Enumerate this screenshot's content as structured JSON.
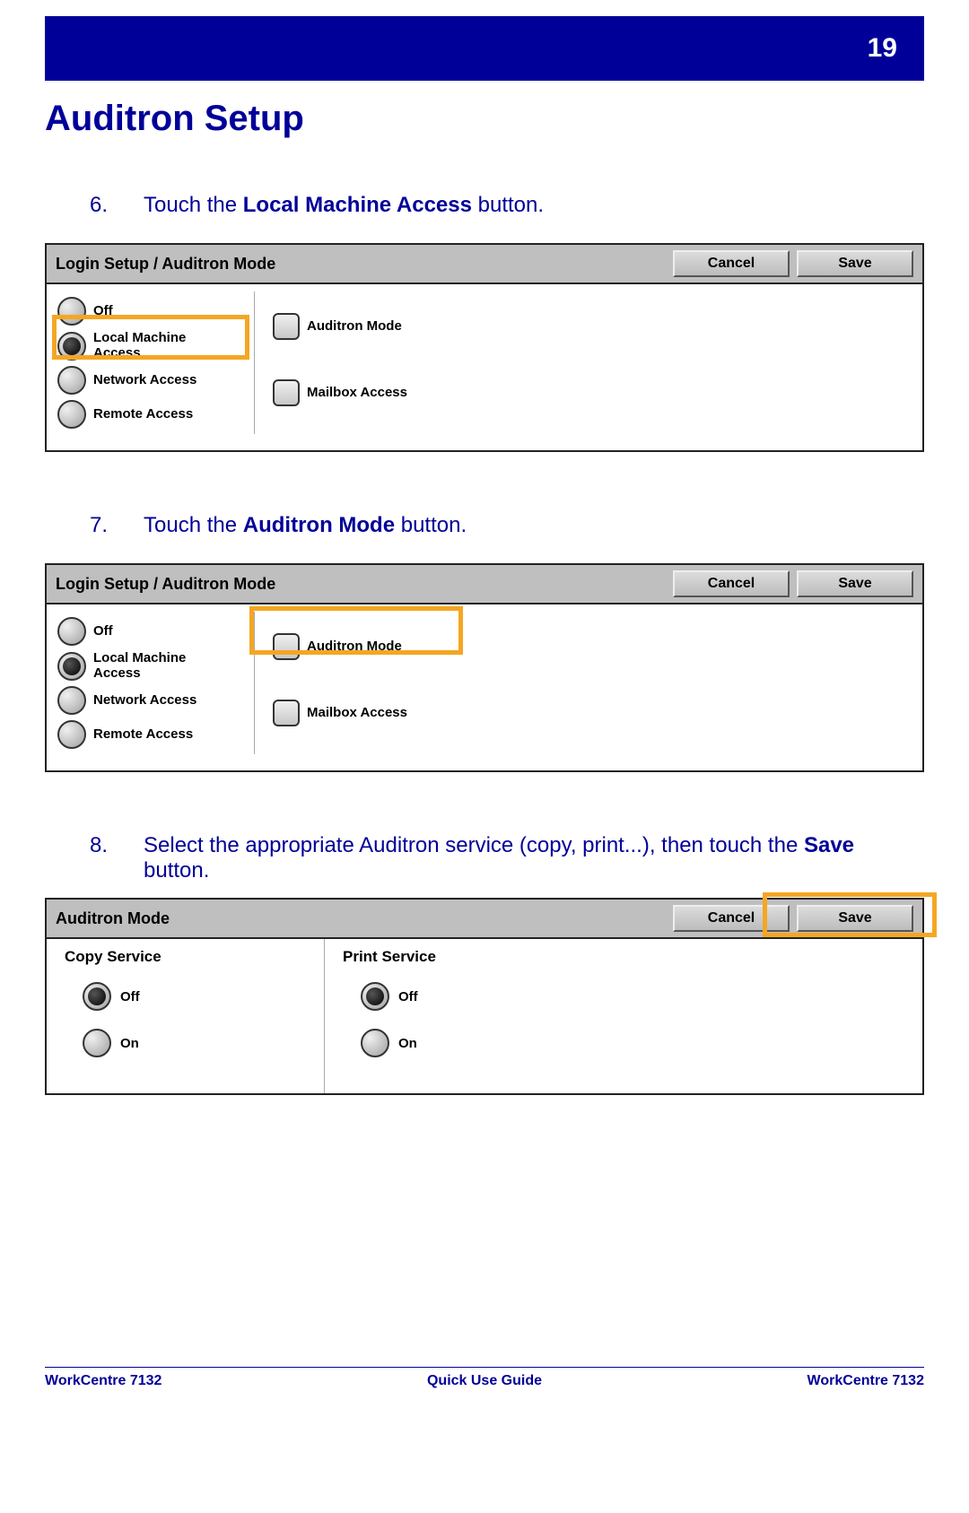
{
  "header": {
    "page_number": "19",
    "title": "Auditron Setup"
  },
  "steps": {
    "s6": {
      "num": "6.",
      "pre": "Touch the ",
      "bold": "Local Machine Access",
      "post": " button."
    },
    "s7": {
      "num": "7.",
      "pre": "Touch the ",
      "bold": "Auditron Mode",
      "post": " button."
    },
    "s8": {
      "num": "8.",
      "pre": "Select the appropriate Auditron service (copy, print...), then touch the ",
      "bold": "Save",
      "post": " button."
    }
  },
  "panel_common": {
    "cancel": "Cancel",
    "save": "Save"
  },
  "panel1": {
    "title": "Login Setup / Auditron Mode",
    "left": {
      "off": "Off",
      "local": "Local Machine Access",
      "network": "Network Access",
      "remote": "Remote Access"
    },
    "right": {
      "auditron": "Auditron Mode",
      "mailbox": "Mailbox Access"
    }
  },
  "panel3": {
    "title": "Auditron Mode",
    "copy_service": "Copy Service",
    "print_service": "Print Service",
    "off": "Off",
    "on": "On"
  },
  "footer": {
    "left": "WorkCentre 7132",
    "center": "Quick Use Guide",
    "right": "WorkCentre 7132"
  }
}
